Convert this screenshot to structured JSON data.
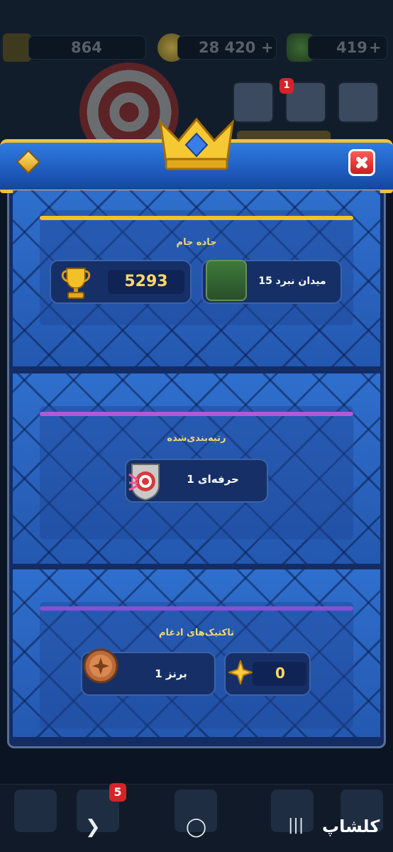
{
  "status_bar": {
    "level_value": "864",
    "gold_value": "28 420",
    "gems_value": "419",
    "plus_sign": "+"
  },
  "notifications": {
    "news_badge": "1",
    "cards_badge": "5"
  },
  "trophy_road": {
    "title": "جاده جام",
    "trophies": "5293",
    "arena_label": "میدان نبرد 15"
  },
  "ranked": {
    "title": "رتبه‌بندی‌شده",
    "league_label": "حرفه‌ای 1"
  },
  "merge_tactics": {
    "title": "تاکتیک‌های ادغام",
    "rank_label": "برنز 1",
    "score": "0"
  },
  "system_nav": {
    "recent": "|||",
    "home": "◯",
    "back": "❯"
  },
  "watermark": "کلشاپ",
  "colors": {
    "trophy_stripe": "#f2c322",
    "ranked_stripe": "#b05ad8",
    "merge_stripe": "#8a4fd4",
    "close_red": "#d52a2c",
    "header_blue": "#2360c6"
  }
}
